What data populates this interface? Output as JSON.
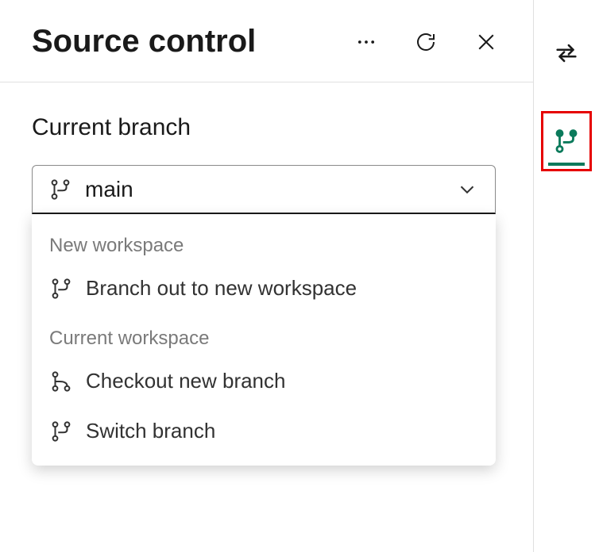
{
  "header": {
    "title": "Source control"
  },
  "section": {
    "label": "Current branch"
  },
  "dropdown": {
    "selected": "main"
  },
  "menu": {
    "group1_label": "New workspace",
    "group1_item1": "Branch out to new workspace",
    "group2_label": "Current workspace",
    "group2_item1": "Checkout new branch",
    "group2_item2": "Switch branch"
  },
  "icons": {
    "more": "more-icon",
    "refresh": "refresh-icon",
    "close": "close-icon",
    "swap": "swap-icon",
    "branch": "branch-icon",
    "chevron": "chevron-down-icon"
  },
  "colors": {
    "accent": "#0b7a5b",
    "highlight_border": "#e60000"
  }
}
